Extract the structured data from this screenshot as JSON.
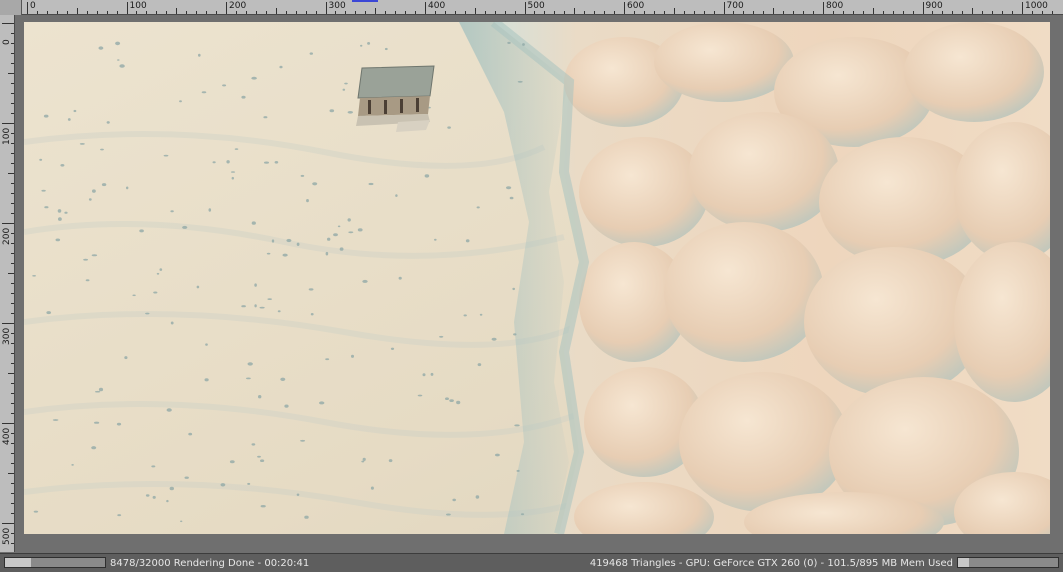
{
  "ruler": {
    "horizontal_labels": [
      "0",
      "100",
      "200",
      "300",
      "400",
      "500",
      "600",
      "700",
      "800",
      "900",
      "1000"
    ],
    "vertical_labels": [
      "0",
      "100",
      "200",
      "300",
      "400",
      "500"
    ]
  },
  "status": {
    "left_text": "8478/32000 Rendering Done - 00:20:41",
    "right_text": "419468 Triangles - GPU: GeForce GTX 260 (0) - 101.5/895 MB Mem Used",
    "render_progress_fraction": 0.26,
    "memory_progress_fraction": 0.11
  },
  "colors": {
    "snow_base": "#e9dfc9",
    "snow_shadow": "#b9c9c4",
    "cliff_warm": "#e8cdb2",
    "ruler_bg": "#bdbdbd",
    "status_bg": "#5e5e5e"
  }
}
